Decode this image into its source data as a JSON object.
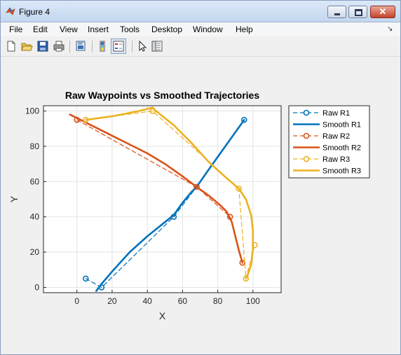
{
  "window": {
    "title": "Figure 4",
    "close_glyph": "✕"
  },
  "menu": [
    "File",
    "Edit",
    "View",
    "Insert",
    "Tools",
    "Desktop",
    "Window",
    "Help"
  ],
  "menu_arrow": "↘",
  "toolbar_icons": [
    "new-figure-icon",
    "open-file-icon",
    "save-icon",
    "print-icon",
    "print-preview-icon",
    "colorbar-icon",
    "legend-icon",
    "pointer-icon",
    "property-inspector-icon"
  ],
  "chart_data": {
    "type": "line",
    "title": "Raw Waypoints vs Smoothed Trajectories",
    "xlabel": "X",
    "ylabel": "Y",
    "xlim": [
      -19,
      116
    ],
    "ylim": [
      -3,
      103
    ],
    "xticks": [
      0,
      20,
      40,
      60,
      80,
      100
    ],
    "yticks": [
      0,
      20,
      40,
      60,
      80,
      100
    ],
    "grid": true,
    "legend_position": "outside-top-right",
    "series": [
      {
        "name": "Raw R1",
        "kind": "raw",
        "color": "#0072BD",
        "x": [
          5,
          14,
          55,
          68,
          95
        ],
        "y": [
          5,
          0,
          40,
          57,
          95
        ]
      },
      {
        "name": "Smooth R1",
        "kind": "smooth",
        "color": "#0072BD",
        "x": [
          11,
          12.5,
          14,
          20,
          30,
          40,
          50,
          55,
          60,
          65,
          68,
          75,
          85,
          95
        ],
        "y": [
          -2,
          0,
          2,
          9,
          20,
          29,
          37,
          41,
          48,
          54,
          57,
          67,
          81,
          95
        ]
      },
      {
        "name": "Raw R2",
        "kind": "raw",
        "color": "#D95319",
        "x": [
          0,
          68,
          87,
          94
        ],
        "y": [
          95,
          57,
          40,
          14
        ]
      },
      {
        "name": "Smooth R2",
        "kind": "smooth",
        "color": "#D95319",
        "x": [
          -4,
          0,
          10,
          20,
          30,
          40,
          50,
          60,
          68,
          75,
          81,
          85,
          88,
          90,
          92,
          94
        ],
        "y": [
          98,
          96,
          91,
          86,
          81,
          76,
          70,
          63,
          57,
          52,
          47,
          43,
          37,
          29,
          21,
          14
        ]
      },
      {
        "name": "Raw R3",
        "kind": "raw",
        "color": "#EDB120",
        "x": [
          5,
          43,
          92,
          96,
          101
        ],
        "y": [
          95,
          100,
          56,
          5,
          24
        ]
      },
      {
        "name": "Smooth R3",
        "kind": "smooth",
        "color": "#EDB120",
        "x": [
          5,
          20,
          35,
          43,
          45,
          55,
          65,
          75,
          85,
          92,
          96,
          99,
          100,
          100,
          99,
          97,
          96
        ],
        "y": [
          95,
          97,
          100,
          102,
          100,
          92,
          82,
          71,
          62,
          56,
          50,
          41,
          32,
          22,
          13,
          7,
          5
        ]
      }
    ]
  }
}
